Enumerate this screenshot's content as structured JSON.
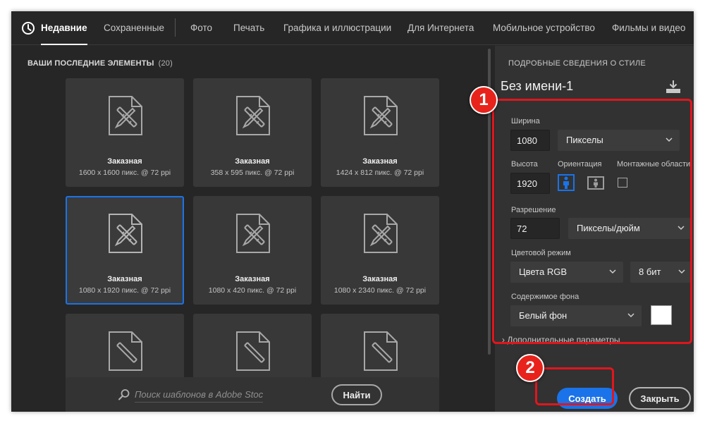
{
  "tabs": [
    {
      "label": "Недавние",
      "active": true
    },
    {
      "label": "Сохраненные"
    },
    {
      "label": "Фото"
    },
    {
      "label": "Печать"
    },
    {
      "label": "Графика и иллюстрации"
    },
    {
      "label": "Для Интернета"
    },
    {
      "label": "Мобильное устройство"
    },
    {
      "label": "Фильмы и видео"
    }
  ],
  "recent": {
    "title": "ВАШИ ПОСЛЕДНИЕ ЭЛЕМЕНТЫ",
    "count": "(20)",
    "items": [
      {
        "name": "Заказная",
        "dims": "1600 x 1600 пикс. @ 72 ppi"
      },
      {
        "name": "Заказная",
        "dims": "358 x 595 пикс. @ 72 ppi"
      },
      {
        "name": "Заказная",
        "dims": "1424 x 812 пикс. @ 72 ppi"
      },
      {
        "name": "Заказная",
        "dims": "1080 x 1920 пикс. @ 72 ppi",
        "selected": true
      },
      {
        "name": "Заказная",
        "dims": "1080 x 420 пикс. @ 72 ppi"
      },
      {
        "name": "Заказная",
        "dims": "1080 x 2340 пикс. @ 72 ppi"
      }
    ]
  },
  "search": {
    "placeholder": "Поиск шаблонов в Adobe Stock",
    "button": "Найти"
  },
  "details": {
    "title": "ПОДРОБНЫЕ СВЕДЕНИЯ О СТИЛЕ",
    "doc_name": "Без имени-1",
    "width_label": "Ширина",
    "width_value": "1080",
    "width_unit": "Пикселы",
    "height_label": "Высота",
    "height_value": "1920",
    "orientation_label": "Ориентация",
    "artboards_label": "Монтажные области",
    "resolution_label": "Разрешение",
    "resolution_value": "72",
    "resolution_unit": "Пикселы/дюйм",
    "color_mode_label": "Цветовой режим",
    "color_mode": "Цвета RGB",
    "bit_depth": "8 бит",
    "background_label": "Содержимое фона",
    "background": "Белый фон",
    "background_color": "#ffffff",
    "advanced": "Дополнительные параметры"
  },
  "actions": {
    "create": "Создать",
    "close": "Закрыть"
  },
  "annotations": [
    {
      "label": "1"
    },
    {
      "label": "2"
    }
  ],
  "colors": {
    "accent": "#1a73e8",
    "annotation": "#e0161e"
  }
}
